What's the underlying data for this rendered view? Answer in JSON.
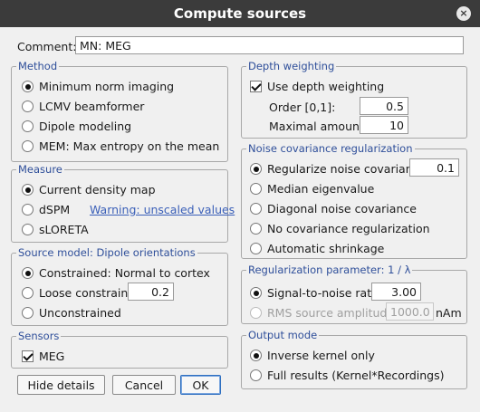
{
  "window": {
    "title": "Compute sources",
    "close_glyph": "×"
  },
  "comment": {
    "label": "Comment:",
    "value": "MN: MEG"
  },
  "method": {
    "title": "Method",
    "options": [
      {
        "label": "Minimum norm imaging",
        "selected": true
      },
      {
        "label": "LCMV beamformer",
        "selected": false
      },
      {
        "label": "Dipole modeling",
        "selected": false
      },
      {
        "label": "MEM: Max entropy on the mean",
        "selected": false
      }
    ]
  },
  "measure": {
    "title": "Measure",
    "options": [
      {
        "label": "Current density map",
        "selected": true
      },
      {
        "label": "dSPM",
        "selected": false
      },
      {
        "label": "sLORETA",
        "selected": false
      }
    ],
    "warning": "Warning: unscaled values"
  },
  "source_model": {
    "title": "Source model: Dipole orientations",
    "constrained": "Constrained:  Normal to cortex",
    "loose": "Loose constraints",
    "loose_value": "0.2",
    "unconstrained": "Unconstrained"
  },
  "sensors": {
    "title": "Sensors",
    "meg": "MEG"
  },
  "buttons": {
    "hide_details": "Hide details",
    "cancel": "Cancel",
    "ok": "OK"
  },
  "depth": {
    "title": "Depth weighting",
    "use_label": "Use depth weighting",
    "order_label": "Order [0,1]:",
    "order_value": "0.5",
    "max_label": "Maximal amount:",
    "max_value": "10"
  },
  "noise": {
    "title": "Noise covariance regularization",
    "regularize_label": "Regularize noise covariance:",
    "regularize_value": "0.1",
    "median": "Median eigenvalue",
    "diagonal": "Diagonal noise covariance",
    "no_reg": "No covariance regularization",
    "shrinkage": "Automatic shrinkage"
  },
  "regparam": {
    "title": "Regularization parameter: 1 / λ",
    "snr_label": "Signal-to-noise ratio:",
    "snr_value": "3.00",
    "rms_label": "RMS source amplitude:",
    "rms_value": "1000.00",
    "rms_unit": "nAm"
  },
  "output": {
    "title": "Output mode",
    "kernel": "Inverse kernel only",
    "full": "Full results (Kernel*Recordings)"
  },
  "colors": {
    "titlebar": "#3b3b3b",
    "group_title": "#2f4f9a",
    "link": "#3a5fb8",
    "background": "#f0f0f0"
  }
}
